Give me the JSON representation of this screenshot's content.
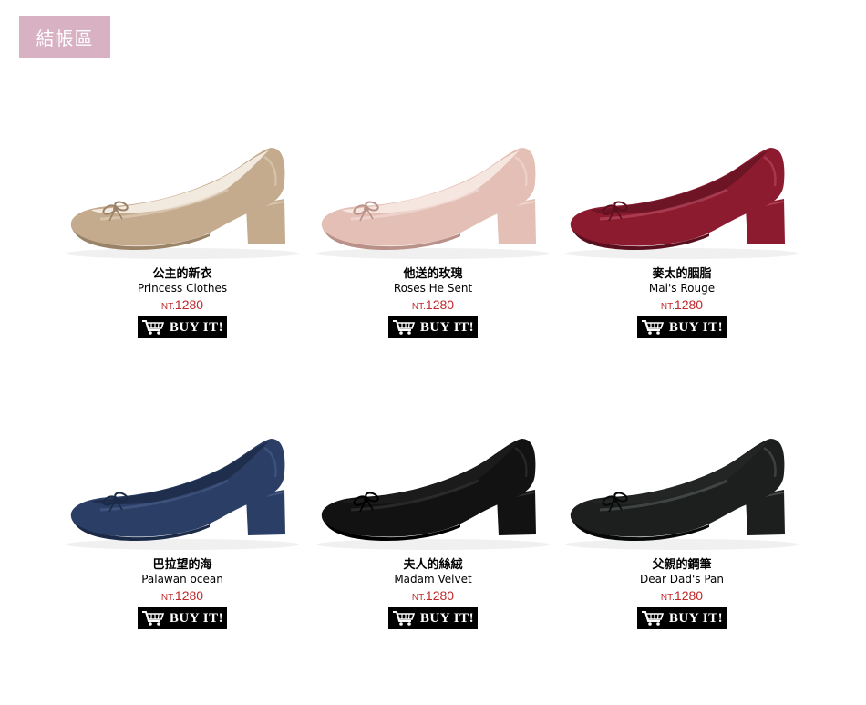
{
  "header": {
    "checkout_label": "結帳區"
  },
  "products": [
    {
      "name_zh": "公主的新衣",
      "name_en": "Princess Clothes",
      "currency": "NT.",
      "price": "1280",
      "buy_label": "BUY IT!",
      "color": "#c4ab8e",
      "dark": "#9a8367",
      "light": "#e6d5c2",
      "lining": "#f2e9df"
    },
    {
      "name_zh": "他送的玫瑰",
      "name_en": "Roses He Sent",
      "currency": "NT.",
      "price": "1280",
      "buy_label": "BUY IT!",
      "color": "#e3bfb5",
      "dark": "#b99188",
      "light": "#f6e2dc",
      "lining": "#f5e6df"
    },
    {
      "name_zh": "麥太的胭脂",
      "name_en": "Mai's Rouge",
      "currency": "NT.",
      "price": "1280",
      "buy_label": "BUY IT!",
      "color": "#8c1b30",
      "dark": "#5a0f1e",
      "light": "#c2546a",
      "lining": "#6e1525"
    },
    {
      "name_zh": "巴拉望的海",
      "name_en": "Palawan ocean",
      "currency": "NT.",
      "price": "1280",
      "buy_label": "BUY IT!",
      "color": "#2b3f66",
      "dark": "#1b2a47",
      "light": "#4d6390",
      "lining": "#1e2e4c"
    },
    {
      "name_zh": "夫人的絲絨",
      "name_en": "Madam Velvet",
      "currency": "NT.",
      "price": "1280",
      "buy_label": "BUY IT!",
      "color": "#121212",
      "dark": "#000000",
      "light": "#3a3a3a",
      "lining": "#1b1b1b"
    },
    {
      "name_zh": "父親的鋼筆",
      "name_en": "Dear Dad's Pan",
      "currency": "NT.",
      "price": "1280",
      "buy_label": "BUY IT!",
      "color": "#1c1f1e",
      "dark": "#070808",
      "light": "#5c6360",
      "lining": "#222524"
    }
  ]
}
